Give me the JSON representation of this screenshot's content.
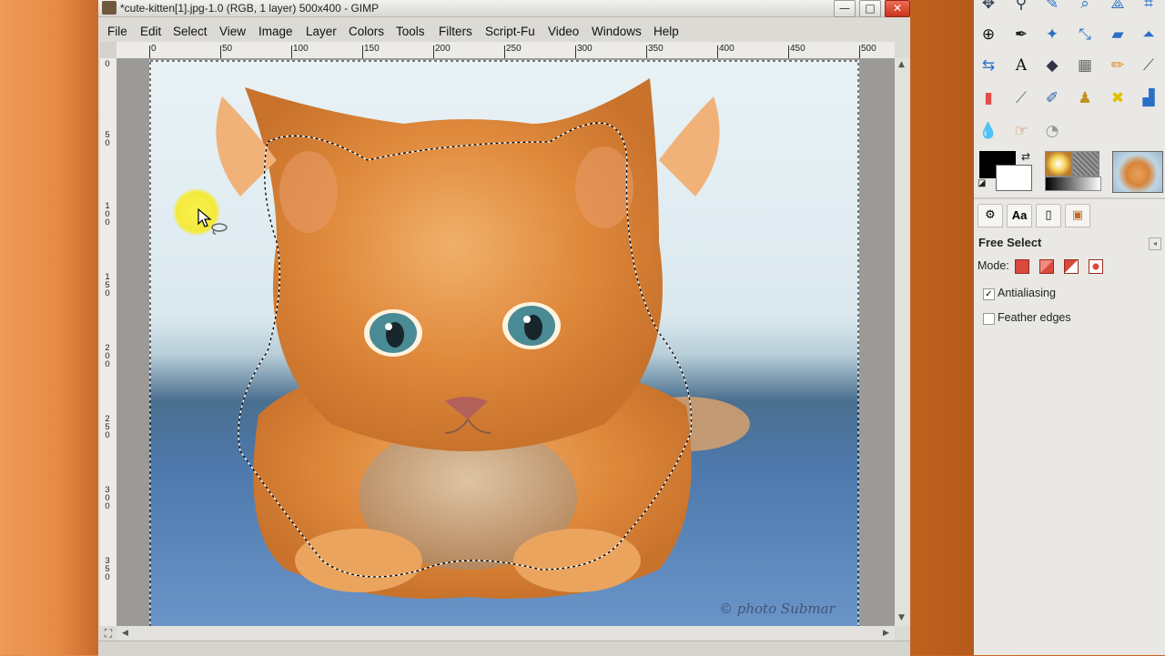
{
  "window": {
    "title": "*cute-kitten[1].jpg-1.0 (RGB, 1 layer) 500x400 - GIMP",
    "controls": {
      "minimize": "—",
      "maximize": "□",
      "close": "✕"
    }
  },
  "menubar": {
    "items": [
      "File",
      "Edit",
      "Select",
      "View",
      "Image",
      "Layer",
      "Colors",
      "Tools",
      "Filters",
      "Script-Fu",
      "Video",
      "Windows",
      "Help"
    ]
  },
  "rulers": {
    "horizontal": [
      "0",
      "50",
      "100",
      "150",
      "200",
      "250",
      "300",
      "350",
      "400",
      "450",
      "500"
    ],
    "vertical": [
      "0",
      "5\n0",
      "1\n0\n0",
      "1\n5\n0",
      "2\n0\n0",
      "2\n5\n0",
      "3\n0\n0",
      "3\n5\n0"
    ]
  },
  "canvas": {
    "image_name": "cute-kitten[1].jpg",
    "watermark": "© photo Submar",
    "selection_tool": "Free Select"
  },
  "toolbox": {
    "icons": [
      "move-tool-icon",
      "align-tool-icon",
      "paths-tool-icon",
      "zoom-tool-icon",
      "measure-tool-icon",
      "rect-select-icon",
      "crop-tool-icon",
      "rotate-tool-icon",
      "scale-tool-icon",
      "shear-tool-icon",
      "flip-tool-icon",
      "text-tool-icon",
      "bucket-fill-icon",
      "blend-tool-icon",
      "pencil-tool-icon",
      "eraser-tool-icon",
      "airbrush-icon",
      "ink-tool-icon",
      "clone-tool-icon",
      "heal-tool-icon",
      "blur-tool-icon",
      "smudge-tool-icon",
      "dodge-burn-icon"
    ],
    "colors": {
      "foreground": "#000000",
      "background": "#ffffff"
    }
  },
  "dock_tabs": [
    "tool-options-tab",
    "fonts-tab",
    "document-tab",
    "images-tab"
  ],
  "tool_options": {
    "title": "Free Select",
    "mode_label": "Mode:",
    "modes": [
      "replace",
      "add",
      "subtract",
      "intersect"
    ],
    "antialiasing": {
      "label": "Antialiasing",
      "checked": true,
      "mark": "✓"
    },
    "feather": {
      "label": "Feather edges",
      "checked": false,
      "mark": ""
    }
  },
  "accent_colors": {
    "mode_button": "#d94a3c",
    "close_button": "#c8321c"
  }
}
